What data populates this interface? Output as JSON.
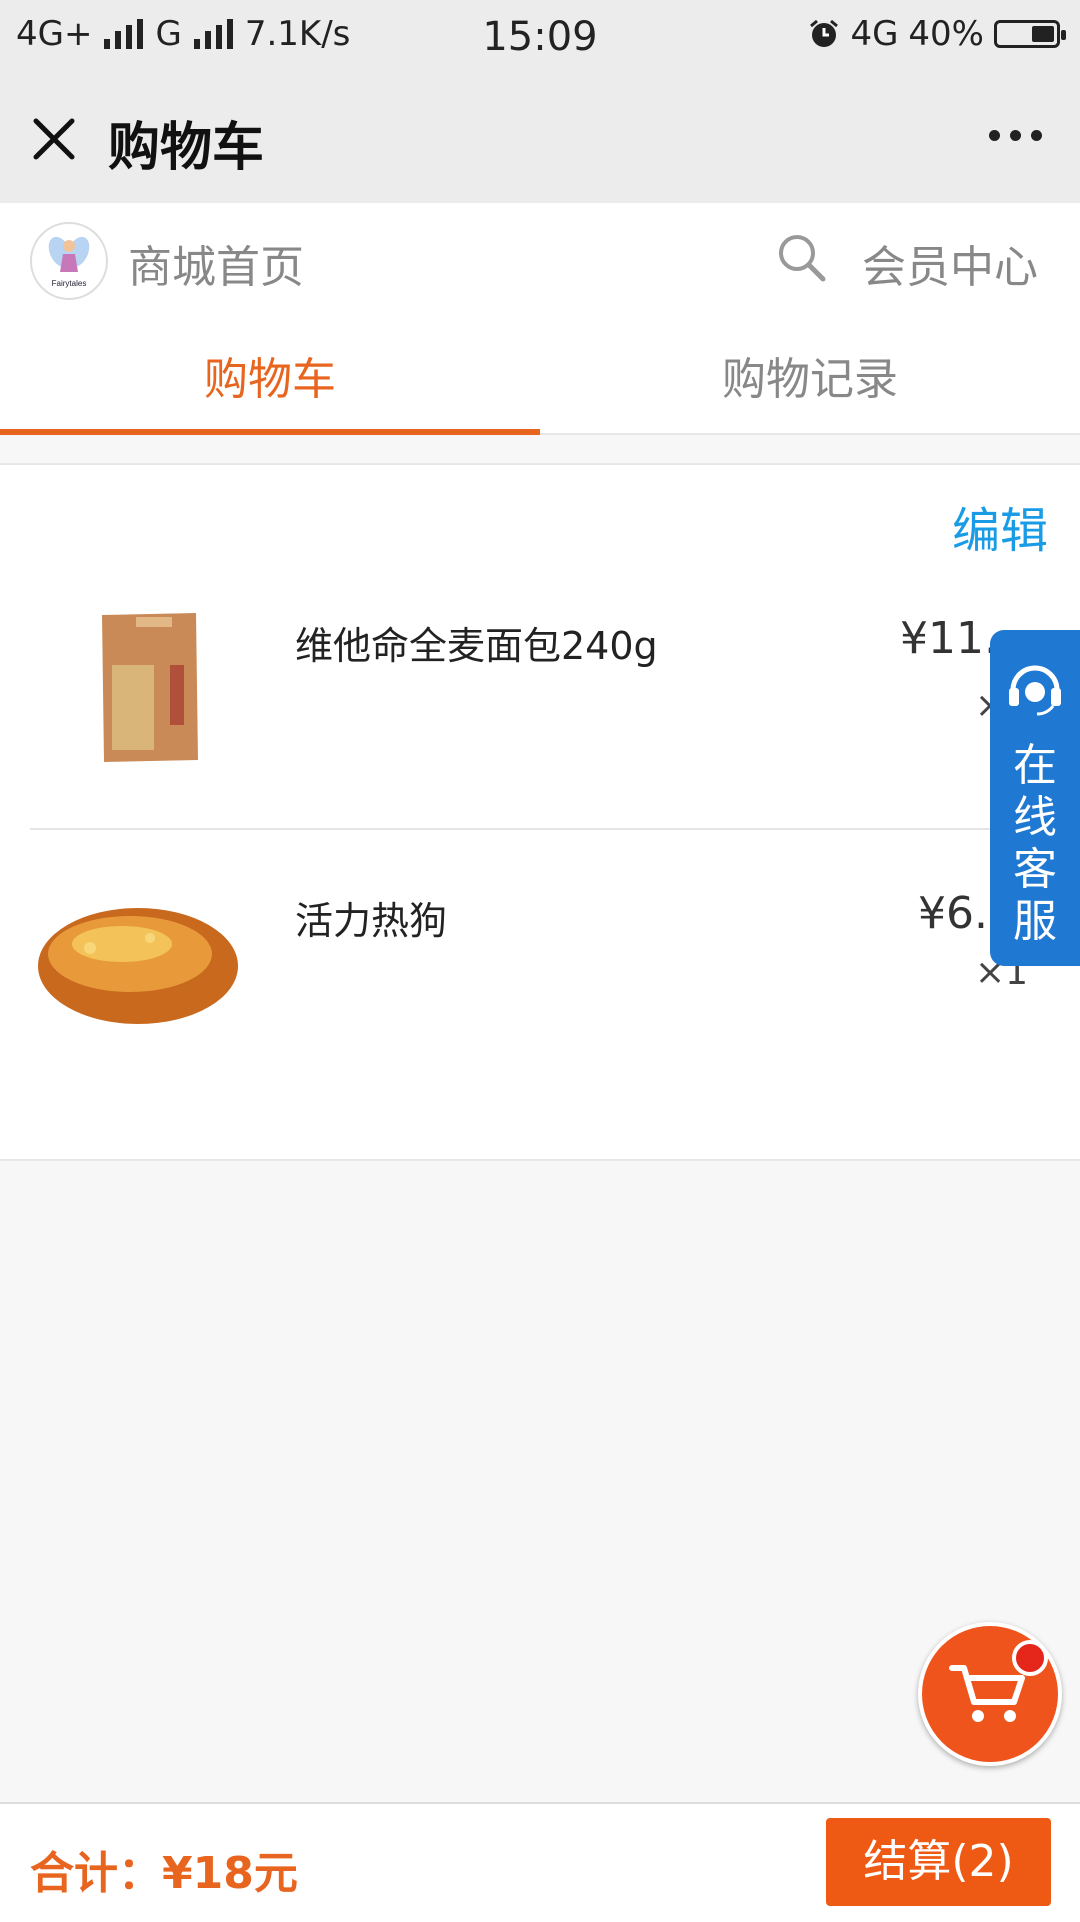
{
  "status_bar": {
    "network_left": "4G+",
    "network_mid": "G",
    "speed": "7.1K/s",
    "time": "15:09",
    "network_right": "4G",
    "battery": "40%",
    "battery_level": 0.4
  },
  "nav": {
    "title": "购物车",
    "close_icon": "close-icon",
    "more_icon": "more-icon"
  },
  "shop": {
    "logo_text": "Fairytales",
    "home_label": "商城首页",
    "member_label": "会员中心"
  },
  "tabs": [
    {
      "label": "购物车",
      "active": true
    },
    {
      "label": "购物记录",
      "active": false
    }
  ],
  "cart": {
    "edit_label": "编辑",
    "items": [
      {
        "name": "维他命全麦面包240g",
        "price": "¥11.",
        "qty": "×"
      },
      {
        "name": "活力热狗",
        "price": "¥6.",
        "qty": "×1"
      }
    ]
  },
  "customer_service": {
    "label_chars": [
      "在",
      "线",
      "客",
      "服"
    ],
    "icon": "headset-icon"
  },
  "footer": {
    "total": "合计：¥18元",
    "checkout_label": "结算(2)"
  },
  "colors": {
    "accent": "#e8651f",
    "link": "#1a9be6",
    "service": "#1f78d1",
    "checkout": "#ee5a14"
  }
}
